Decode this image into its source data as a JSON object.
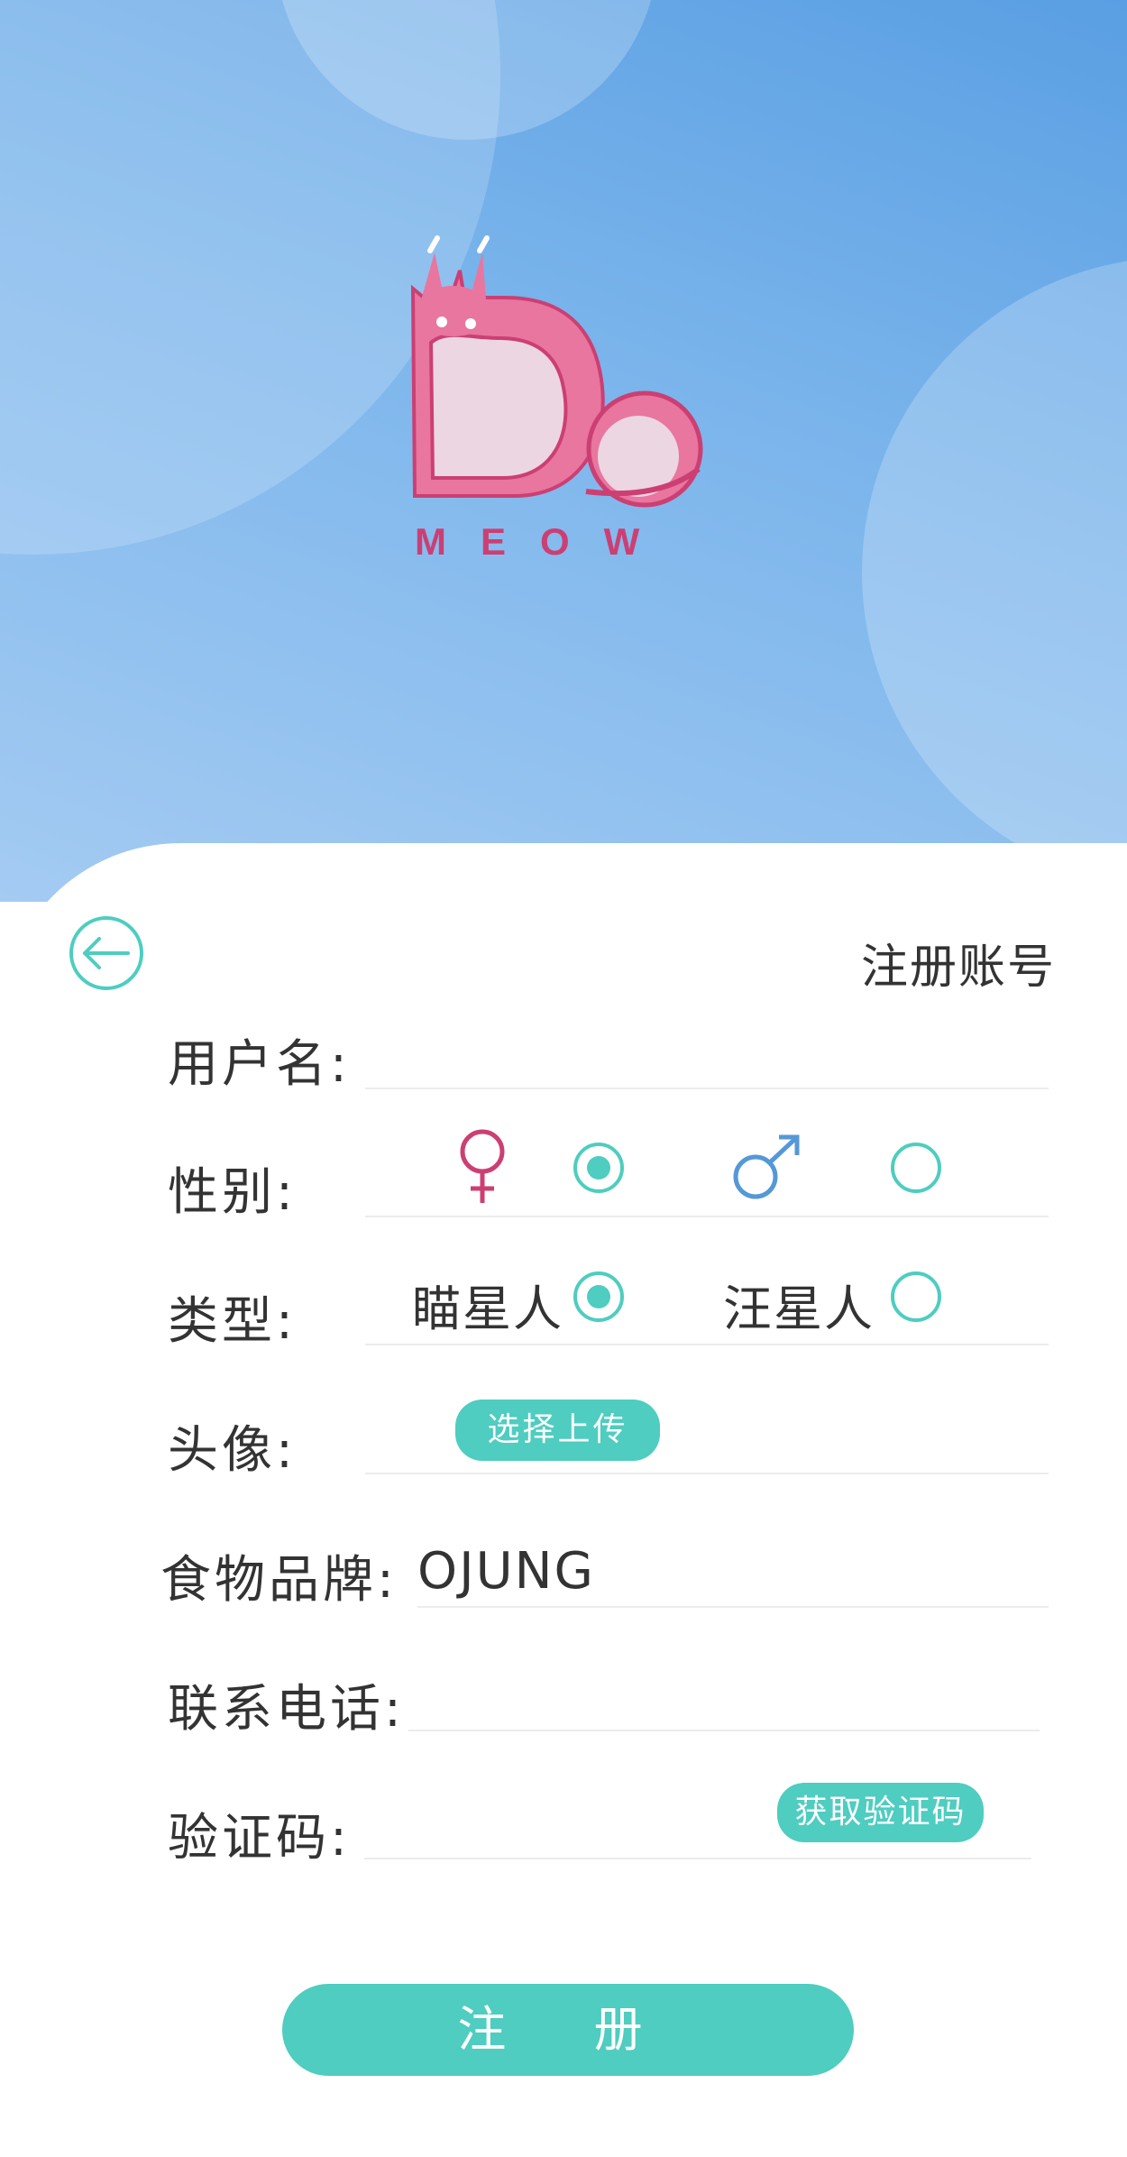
{
  "header": {
    "title": "注册账号"
  },
  "logo": {
    "text": "MEOW",
    "colors": {
      "primary": "#e8769f",
      "dark": "#cc3f73",
      "light": "#ecd6e2"
    }
  },
  "form": {
    "username": {
      "label": "用户名:",
      "value": ""
    },
    "gender": {
      "label": "性别:",
      "options": [
        {
          "icon": "female-symbol-icon",
          "selected": true
        },
        {
          "icon": "male-symbol-icon",
          "selected": false
        }
      ]
    },
    "type": {
      "label": "类型:",
      "options": [
        {
          "label": "瞄星人",
          "selected": true
        },
        {
          "label": "汪星人",
          "selected": false
        }
      ]
    },
    "avatar": {
      "label": "头像:",
      "upload_label": "选择上传"
    },
    "food_brand": {
      "label": "食物品牌:",
      "value": "OJUNG"
    },
    "phone": {
      "label": "联系电话:",
      "value": ""
    },
    "code": {
      "label": "验证码:",
      "button_label": "获取验证码",
      "value": ""
    }
  },
  "submit_label": "注 册",
  "colors": {
    "accent": "#4ecdc0",
    "female": "#cc3f73",
    "male": "#5598d6",
    "sky": "#6aa9e8"
  }
}
